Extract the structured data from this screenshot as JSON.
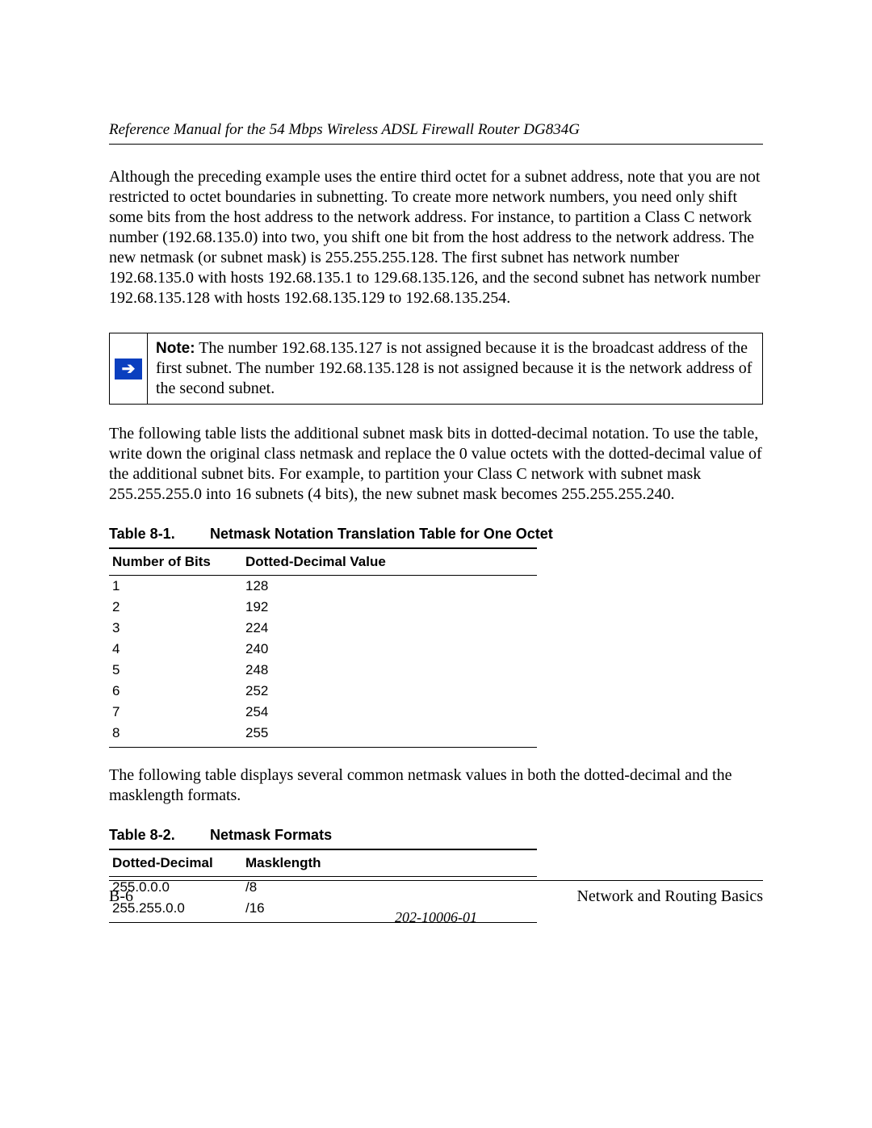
{
  "header": {
    "running_title": "Reference Manual for the 54 Mbps Wireless ADSL Firewall Router DG834G"
  },
  "paragraphs": {
    "p1": "Although the preceding example uses the entire third octet for a subnet address, note that you are not restricted to octet boundaries in subnetting. To create more network numbers, you need only shift some bits from the host address to the network address. For instance, to partition a Class C network number (192.68.135.0) into two, you shift one bit from the host address to the network address. The new netmask (or subnet mask) is 255.255.255.128. The first subnet has network number 192.68.135.0 with hosts 192.68.135.1 to 129.68.135.126, and the second subnet has network number 192.68.135.128 with hosts 192.68.135.129 to 192.68.135.254.",
    "p2": "The following table lists the additional subnet mask bits in dotted-decimal notation. To use the table, write down the original class netmask and replace the 0 value octets with the dotted-decimal value of the additional subnet bits. For example, to partition your Class C network with subnet mask 255.255.255.0 into 16 subnets (4 bits), the new subnet mask becomes 255.255.255.240.",
    "p3": "The following table displays several common netmask values in both the dotted-decimal and the masklength formats."
  },
  "note": {
    "label": "Note:",
    "text": " The number 192.68.135.127 is not assigned because it is the broadcast address of the first subnet. The number 192.68.135.128 is not assigned because it is the network address of the second subnet."
  },
  "table1": {
    "caption_label": "Table 8-1.",
    "caption_title": "Netmask Notation Translation Table for One Octet",
    "head_a": "Number of Bits",
    "head_b": "Dotted-Decimal Value",
    "rows": [
      {
        "a": "1",
        "b": "128"
      },
      {
        "a": "2",
        "b": "192"
      },
      {
        "a": "3",
        "b": "224"
      },
      {
        "a": "4",
        "b": "240"
      },
      {
        "a": "5",
        "b": "248"
      },
      {
        "a": "6",
        "b": "252"
      },
      {
        "a": "7",
        "b": "254"
      },
      {
        "a": "8",
        "b": "255"
      }
    ]
  },
  "table2": {
    "caption_label": "Table 8-2.",
    "caption_title": "Netmask Formats",
    "head_a": "Dotted-Decimal",
    "head_b": "Masklength",
    "rows": [
      {
        "a": "255.0.0.0",
        "b": "/8"
      },
      {
        "a": "255.255.0.0",
        "b": "/16"
      }
    ]
  },
  "footer": {
    "page_num": "B-6",
    "chapter": "Network and Routing Basics",
    "doc_num": "202-10006-01"
  }
}
